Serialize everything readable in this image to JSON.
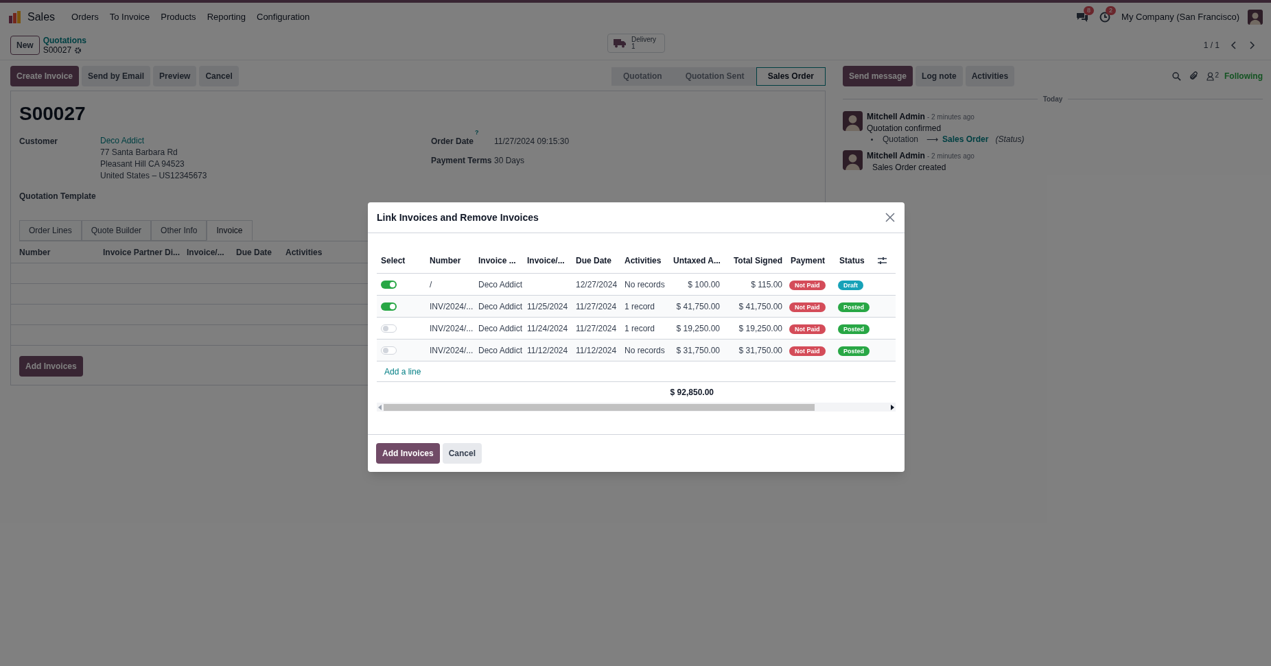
{
  "navbar": {
    "app": "Sales",
    "menu": [
      "Orders",
      "To Invoice",
      "Products",
      "Reporting",
      "Configuration"
    ],
    "messages_count": "8",
    "activities_count": "2",
    "company": "My Company (San Francisco)"
  },
  "control_panel": {
    "new_button": "New",
    "breadcrumb": "Quotations",
    "record": "S00027",
    "smart_button": {
      "label": "Delivery",
      "count": "1"
    },
    "pager": "1 / 1"
  },
  "actions": [
    "Create Invoice",
    "Send by Email",
    "Preview",
    "Cancel"
  ],
  "statusbar": [
    {
      "label": "Quotation",
      "selected": false
    },
    {
      "label": "Quotation Sent",
      "selected": false
    },
    {
      "label": "Sales Order",
      "selected": true
    }
  ],
  "form": {
    "title": "S00027",
    "customer_label": "Customer",
    "customer": "Deco Addict",
    "address": [
      "77 Santa Barbara Rd",
      "Pleasant Hill CA 94523",
      "United States – US12345673"
    ],
    "order_date_label": "Order Date",
    "order_date_help": "?",
    "order_date": "11/27/2024 09:15:30",
    "payment_terms_label": "Payment Terms",
    "payment_terms": "30 Days",
    "template_label": "Quotation Template",
    "tabs": [
      {
        "label": "Order Lines",
        "selected": false
      },
      {
        "label": "Quote Builder",
        "selected": false
      },
      {
        "label": "Other Info",
        "selected": false
      },
      {
        "label": "Invoice",
        "selected": true
      }
    ],
    "invoice_columns": [
      "Number",
      "Invoice Partner Di...",
      "Invoice/...",
      "Due Date",
      "Activities"
    ],
    "add_button": "Add Invoices"
  },
  "chatter": {
    "buttons": [
      "Send message",
      "Log note",
      "Activities"
    ],
    "followers_count": "2",
    "following": "Following",
    "date_separator": "Today",
    "messages": [
      {
        "author": "Mitchell Admin",
        "time": "- 2 minutes ago",
        "body": "Quotation confirmed",
        "change": {
          "old": "Quotation",
          "arrow": "⟶",
          "new": "Sales Order",
          "field": "(Status)"
        }
      },
      {
        "author": "Mitchell Admin",
        "time": "- 2 minutes ago",
        "body": "Sales Order created"
      }
    ]
  },
  "dialog": {
    "title": "Link Invoices and Remove Invoices",
    "columns": [
      "Select",
      "Number",
      "Invoice ...",
      "Invoice/...",
      "Due Date",
      "Activities",
      "Untaxed A...",
      "Total Signed",
      "Payment",
      "Status"
    ],
    "rows": [
      {
        "selected": true,
        "number": "/",
        "partner": "Deco Addict",
        "invoice_date": "",
        "due_date": "12/27/2024",
        "activities": "No records",
        "untaxed": "$ 100.00",
        "total": "$ 115.00",
        "payment": {
          "label": "Not Paid",
          "color": "#d44c59"
        },
        "status": {
          "label": "Draft",
          "color": "#17a2b8"
        }
      },
      {
        "selected": true,
        "number": "INV/2024/...",
        "partner": "Deco Addict",
        "invoice_date": "11/25/2024",
        "due_date": "11/27/2024",
        "activities": "1 record",
        "untaxed": "$ 41,750.00",
        "total": "$ 41,750.00",
        "payment": {
          "label": "Not Paid",
          "color": "#d44c59"
        },
        "status": {
          "label": "Posted",
          "color": "#28a745"
        }
      },
      {
        "selected": false,
        "number": "INV/2024/...",
        "partner": "Deco Addict",
        "invoice_date": "11/24/2024",
        "due_date": "11/27/2024",
        "activities": "1 record",
        "untaxed": "$ 19,250.00",
        "total": "$ 19,250.00",
        "payment": {
          "label": "Not Paid",
          "color": "#d44c59"
        },
        "status": {
          "label": "Posted",
          "color": "#28a745"
        }
      },
      {
        "selected": false,
        "number": "INV/2024/...",
        "partner": "Deco Addict",
        "invoice_date": "11/12/2024",
        "due_date": "11/12/2024",
        "activities": "No records",
        "untaxed": "$ 31,750.00",
        "total": "$ 31,750.00",
        "payment": {
          "label": "Not Paid",
          "color": "#d44c59"
        },
        "status": {
          "label": "Posted",
          "color": "#28a745"
        }
      }
    ],
    "add_line": "Add a line",
    "untaxed_total": "$ 92,850.00",
    "buttons": [
      "Add Invoices",
      "Cancel"
    ]
  }
}
